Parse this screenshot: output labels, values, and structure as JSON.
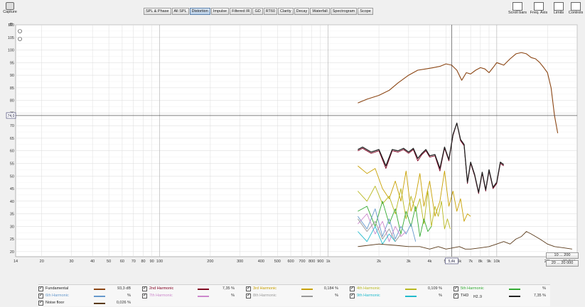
{
  "toolbar": {
    "capture_label": "Capture",
    "right_buttons": [
      "Scroll bars",
      "Freq. Axis",
      "Limits",
      "Controls"
    ]
  },
  "tabs": [
    "SPL & Phase",
    "All SPL",
    "Distortion",
    "Impulse",
    "Filtered IR",
    "GD",
    "RT60",
    "Clarity",
    "Decay",
    "Waterfall",
    "Spectrogram",
    "Scope"
  ],
  "active_tab": "Distortion",
  "axes": {
    "y_unit": "dB",
    "y_ticks": [
      "110",
      "105",
      "100",
      "95",
      "90",
      "85",
      "80",
      "75",
      "70",
      "65",
      "60",
      "55",
      "50",
      "45",
      "40",
      "35",
      "30",
      "25",
      "20"
    ],
    "x_ticks": [
      "14",
      "20",
      "30",
      "40",
      "50",
      "60",
      "70",
      "80",
      "90",
      "100",
      "200",
      "300",
      "400",
      "500",
      "600",
      "700",
      "800",
      "900",
      "1k",
      "2k",
      "3k",
      "4k",
      "5k",
      "6k",
      "7k",
      "8k",
      "9k",
      "10k",
      "20k",
      "30,0kHz"
    ],
    "cursor_y_label": "74,0",
    "cursor_x_label": "5,4k"
  },
  "range_buttons": [
    "10 ... 200",
    "20 ... 20 000"
  ],
  "legend": [
    {
      "name": "Fundamental",
      "value": "93,3 dB",
      "color": "#8b4513"
    },
    {
      "name": "2nd Harmonic",
      "value": "7,35 %",
      "color": "#800020"
    },
    {
      "name": "3rd Harmonic",
      "value": "0,184 %",
      "color": "#c8a000"
    },
    {
      "name": "4th Harmonic",
      "value": "0,109 %",
      "color": "#b8b820"
    },
    {
      "name": "5th Harmonic",
      "value": "%",
      "color": "#33aa33"
    },
    {
      "name": "6th Harmonic",
      "value": "%",
      "color": "#6699cc"
    },
    {
      "name": "7th Harmonic",
      "value": "%",
      "color": "#cc88cc"
    },
    {
      "name": "8th Harmonic",
      "value": "%",
      "color": "#999999"
    },
    {
      "name": "9th Harmonic",
      "value": "%",
      "color": "#22bbcc"
    },
    {
      "name": "THD",
      "value": "7,35 %",
      "color": "#222222",
      "note": "H2..9"
    },
    {
      "name": "Noise floor",
      "value": "0,026 %",
      "color": "#5a3a1a"
    }
  ],
  "chart_data": {
    "type": "line",
    "xlabel": "",
    "ylabel": "dB",
    "xlim": [
      14,
      30000
    ],
    "ylim": [
      18,
      110
    ],
    "x_scale": "log",
    "grid": true,
    "series": [
      {
        "name": "Fundamental",
        "x": [
          1500,
          1700,
          2000,
          2300,
          2600,
          3000,
          3400,
          3800,
          4200,
          4600,
          5000,
          5400,
          5800,
          6200,
          6600,
          7000,
          7500,
          8000,
          8500,
          9000,
          9500,
          10000,
          11000,
          12000,
          13000,
          14000,
          15000,
          16000,
          17000,
          18000,
          19000,
          20000,
          21000,
          22000,
          23000
        ],
        "values": [
          79,
          80.5,
          82,
          84,
          87,
          90,
          92,
          92.5,
          93,
          93.5,
          94.5,
          94,
          92,
          88,
          91,
          90.5,
          92,
          93,
          92.5,
          91,
          93,
          95,
          94,
          96.5,
          98.5,
          99,
          98.5,
          97,
          96.5,
          95,
          93,
          91,
          85,
          74,
          67
        ]
      },
      {
        "name": "2nd Harmonic",
        "x": [
          1500,
          1600,
          1800,
          2000,
          2200,
          2400,
          2600,
          2800,
          3000,
          3200,
          3400,
          3600,
          3800,
          4000,
          4300,
          4600,
          4900,
          5200,
          5500,
          5800,
          6100,
          6400,
          6700,
          7000,
          7400,
          7800,
          8200,
          8600,
          9000,
          9500,
          10000,
          10500,
          11000
        ],
        "values": [
          60,
          61,
          59,
          60,
          53,
          60,
          59.5,
          60.5,
          59,
          60.5,
          56,
          58.5,
          60,
          57.5,
          58,
          52,
          61,
          56,
          66,
          71,
          64,
          62,
          47,
          55,
          50,
          43,
          51,
          44,
          52,
          45,
          47,
          55,
          54
        ]
      },
      {
        "name": "3rd Harmonic",
        "x": [
          1500,
          1700,
          1900,
          2100,
          2300,
          2500,
          2700,
          2900,
          3100,
          3300,
          3500,
          3700,
          4000,
          4300,
          4600,
          4900,
          5200,
          5500,
          5800,
          6100,
          6400,
          6700,
          7000
        ],
        "values": [
          54,
          51,
          53,
          45,
          41,
          48,
          40,
          52,
          36,
          42,
          51,
          38,
          48,
          34,
          40,
          52,
          38,
          44,
          36,
          41,
          32,
          35,
          34
        ]
      },
      {
        "name": "4th Harmonic",
        "x": [
          1500,
          1700,
          1900,
          2100,
          2300,
          2500,
          2700,
          2900,
          3100,
          3300,
          3500,
          3700,
          3900,
          4100,
          4300,
          4500,
          4700,
          4900,
          5100,
          5300
        ],
        "values": [
          44,
          40,
          46,
          39,
          42,
          35,
          45,
          33,
          42,
          36,
          41,
          31,
          44,
          30,
          38,
          34,
          40,
          29,
          33,
          29
        ]
      },
      {
        "name": "5th Harmonic",
        "x": [
          1500,
          1700,
          1900,
          2100,
          2300,
          2500,
          2700,
          2900,
          3100,
          3300,
          3500,
          3700,
          3900,
          4100
        ],
        "values": [
          36,
          38,
          30,
          40,
          31,
          37,
          27,
          36,
          30,
          38,
          26,
          33,
          28,
          30
        ]
      },
      {
        "name": "6th Harmonic",
        "x": [
          1500,
          1700,
          1900,
          2100,
          2300,
          2500,
          2700,
          2900,
          3100,
          3300
        ],
        "values": [
          34,
          29,
          37,
          26,
          33,
          25,
          30,
          27,
          31,
          24
        ]
      },
      {
        "name": "7th Harmonic",
        "x": [
          1500,
          1700,
          1900,
          2100,
          2300,
          2500,
          2700,
          2900
        ],
        "values": [
          31,
          35,
          27,
          32,
          24,
          30,
          26,
          28
        ]
      },
      {
        "name": "8th Harmonic",
        "x": [
          1500,
          1700,
          1900,
          2100,
          2300,
          2500,
          2700
        ],
        "values": [
          33,
          28,
          32,
          25,
          29,
          24,
          27
        ]
      },
      {
        "name": "9th Harmonic",
        "x": [
          1500,
          1700,
          1900,
          2100,
          2300,
          2500
        ],
        "values": [
          28,
          24,
          30,
          23,
          27,
          24
        ]
      },
      {
        "name": "THD",
        "x": [
          1500,
          1600,
          1800,
          2000,
          2200,
          2400,
          2600,
          2800,
          3000,
          3200,
          3400,
          3600,
          3800,
          4000,
          4300,
          4600,
          4900,
          5200,
          5500,
          5800,
          6100,
          6400,
          6700,
          7000,
          7400,
          7800,
          8200,
          8600,
          9000,
          9500,
          10000,
          10500,
          11000
        ],
        "values": [
          60.5,
          61.5,
          59.5,
          60.5,
          54,
          60.5,
          60,
          61,
          59.5,
          61,
          57,
          59,
          60.5,
          58,
          58.5,
          53,
          61.5,
          56.5,
          66.5,
          71,
          64.5,
          62.5,
          47.5,
          55.5,
          50.5,
          43.5,
          51.5,
          44.5,
          52.5,
          45.5,
          47.5,
          55.5,
          54.5
        ]
      },
      {
        "name": "Noise floor",
        "x": [
          1500,
          2000,
          2500,
          3000,
          3500,
          4000,
          4500,
          5000,
          5500,
          6000,
          6500,
          7000,
          8000,
          9000,
          10000,
          11000,
          12000,
          13000,
          14000,
          15000,
          16000,
          17000,
          18000,
          19000,
          20000,
          22000,
          25000,
          28000
        ],
        "values": [
          22,
          23,
          22.5,
          22,
          22,
          21,
          22,
          21,
          21.5,
          22,
          21,
          21,
          21.5,
          22,
          23,
          24,
          23,
          25,
          26,
          28,
          27,
          26,
          25,
          24,
          23,
          22,
          21.5,
          21
        ]
      }
    ]
  }
}
